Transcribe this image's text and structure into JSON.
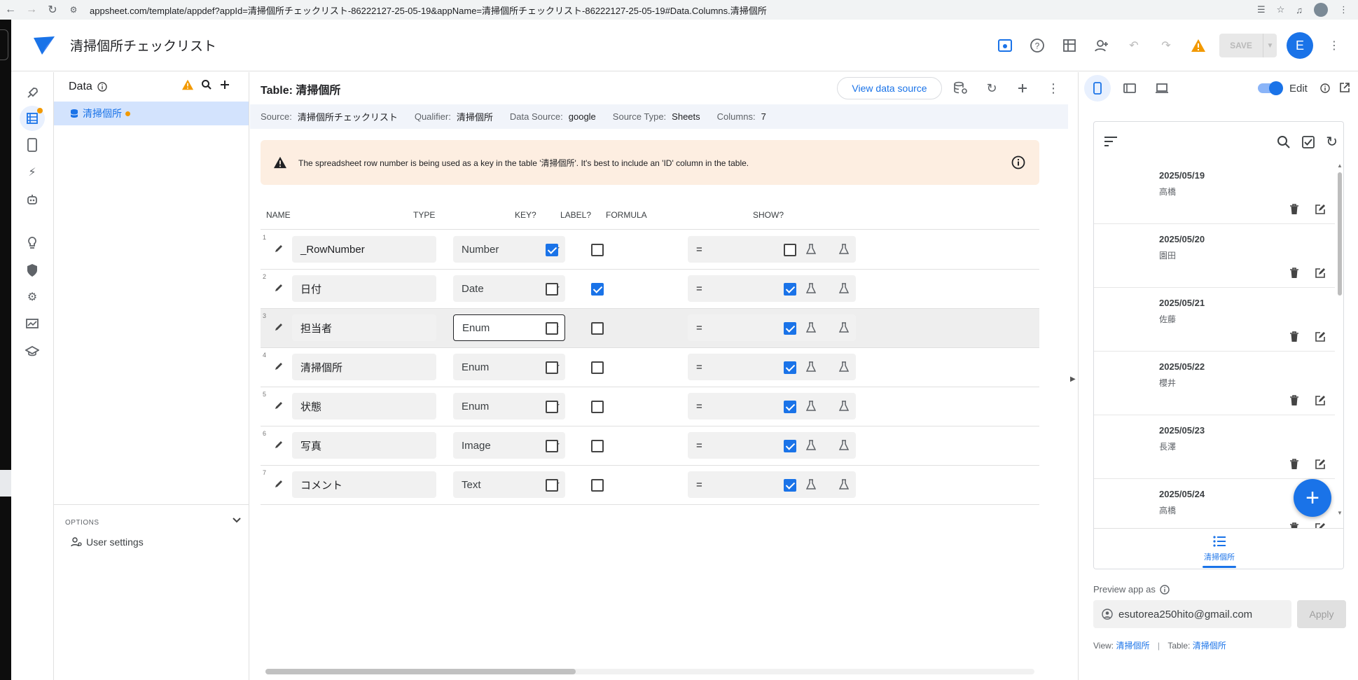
{
  "browser": {
    "url": "appsheet.com/template/appdef?appId=清掃個所チェックリスト-86222127-25-05-19&appName=清掃個所チェックリスト-86222127-25-05-19#Data.Columns.清掃個所"
  },
  "app": {
    "title": "清掃個所チェックリスト",
    "save_label": "SAVE",
    "avatar_letter": "E",
    "accent_color": "#1a73e8",
    "warning_color": "#f29900"
  },
  "data_panel": {
    "title": "Data",
    "table_item": "清掃個所",
    "options_label": "OPTIONS",
    "user_settings": "User settings"
  },
  "main": {
    "table_title": "Table: 清掃個所",
    "view_data_source": "View data source",
    "source": {
      "source_label": "Source:",
      "source_value": "清掃個所チェックリスト",
      "qualifier_label": "Qualifier:",
      "qualifier_value": "清掃個所",
      "datasource_label": "Data Source:",
      "datasource_value": "google",
      "sourcetype_label": "Source Type:",
      "sourcetype_value": "Sheets",
      "columns_label": "Columns:",
      "columns_value": "7"
    },
    "warning": "The spreadsheet row number is being used as a key in the table '清掃個所'. It's best to include an 'ID' column in the table.",
    "headers": {
      "name": "NAME",
      "type": "TYPE",
      "key": "KEY?",
      "label": "LABEL?",
      "formula": "FORMULA",
      "show": "SHOW?"
    },
    "rows": [
      {
        "num": "1",
        "name": "_RowNumber",
        "type": "Number",
        "key": true,
        "label": false,
        "formula": "=",
        "show": false
      },
      {
        "num": "2",
        "name": "日付",
        "type": "Date",
        "key": false,
        "label": true,
        "formula": "=",
        "show": true
      },
      {
        "num": "3",
        "name": "担当者",
        "type": "Enum",
        "key": false,
        "label": false,
        "formula": "=",
        "show": true
      },
      {
        "num": "4",
        "name": "清掃個所",
        "type": "Enum",
        "key": false,
        "label": false,
        "formula": "=",
        "show": true
      },
      {
        "num": "5",
        "name": "状態",
        "type": "Enum",
        "key": false,
        "label": false,
        "formula": "=",
        "show": true
      },
      {
        "num": "6",
        "name": "写真",
        "type": "Image",
        "key": false,
        "label": false,
        "formula": "=",
        "show": true
      },
      {
        "num": "7",
        "name": "コメント",
        "type": "Text",
        "key": false,
        "label": false,
        "formula": "=",
        "show": true
      }
    ]
  },
  "preview": {
    "edit_label": "Edit",
    "items": [
      {
        "date": "2025/05/19",
        "name": "高橋"
      },
      {
        "date": "2025/05/20",
        "name": "園田"
      },
      {
        "date": "2025/05/21",
        "name": "佐藤"
      },
      {
        "date": "2025/05/22",
        "name": "櫻井"
      },
      {
        "date": "2025/05/23",
        "name": "長澤"
      },
      {
        "date": "2025/05/24",
        "name": "高橋"
      }
    ],
    "nav_label": "清掃個所",
    "preview_as_label": "Preview app as",
    "email": "esutorea250hito@gmail.com",
    "apply_label": "Apply",
    "view_label": "View:",
    "view_value": "清掃個所",
    "table_label": "Table:",
    "table_value": "清掃個所"
  }
}
